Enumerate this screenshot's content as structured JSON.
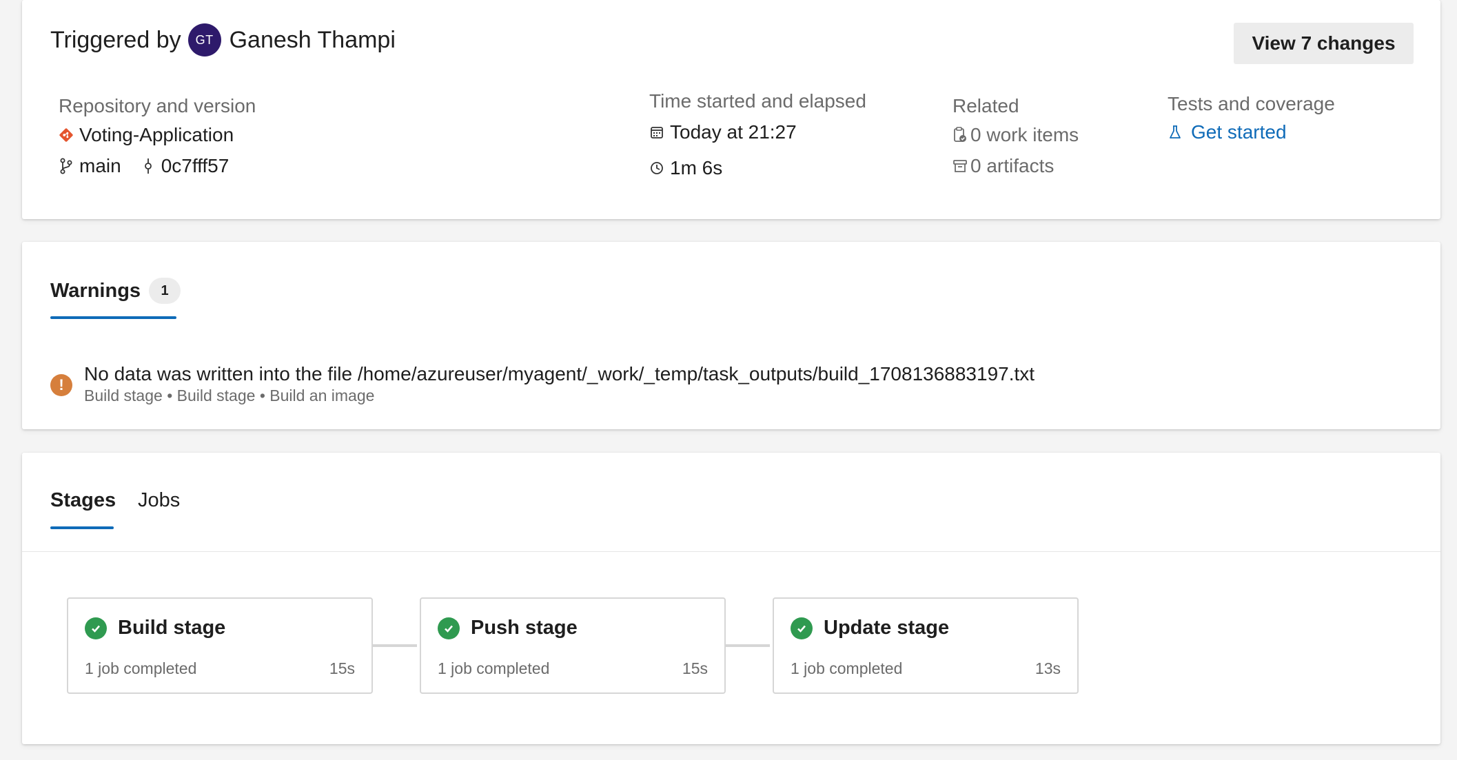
{
  "summary": {
    "triggered_prefix": "Triggered by",
    "avatar_initials": "GT",
    "user_name": "Ganesh Thampi",
    "view_changes_label": "View 7 changes",
    "repository": {
      "label": "Repository and version",
      "name": "Voting-Application",
      "branch": "main",
      "commit": "0c7fff57"
    },
    "time": {
      "label": "Time started and elapsed",
      "started": "Today at 21:27",
      "elapsed": "1m 6s"
    },
    "related": {
      "label": "Related",
      "work_items": "0 work items",
      "artifacts": "0 artifacts"
    },
    "tests": {
      "label": "Tests and coverage",
      "link": "Get started"
    }
  },
  "warnings": {
    "tab_label": "Warnings",
    "count": "1",
    "items": [
      {
        "message": "No data was written into the file /home/azureuser/myagent/_work/_temp/task_outputs/build_1708136883197.txt",
        "path": "Build stage • Build stage • Build an image"
      }
    ]
  },
  "stages_section": {
    "tabs": [
      "Stages",
      "Jobs"
    ],
    "stages": [
      {
        "name": "Build stage",
        "status": "1 job completed",
        "duration": "15s"
      },
      {
        "name": "Push stage",
        "status": "1 job completed",
        "duration": "15s"
      },
      {
        "name": "Update stage",
        "status": "1 job completed",
        "duration": "13s"
      }
    ]
  },
  "colors": {
    "accent": "#0f6bb8",
    "warning": "#d67f3c",
    "success": "#2f9a50",
    "git_brand": "#e4552e",
    "avatar": "#2e1a6b"
  }
}
